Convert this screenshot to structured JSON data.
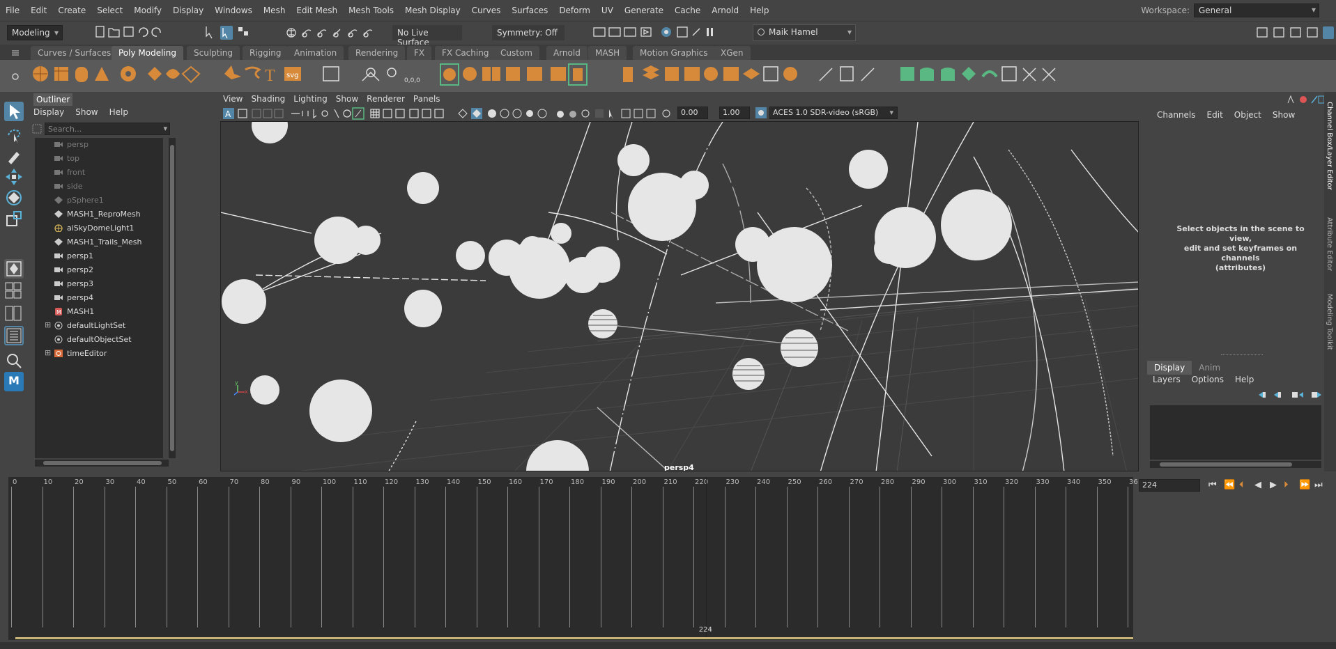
{
  "menubar": {
    "items": [
      "File",
      "Edit",
      "Create",
      "Select",
      "Modify",
      "Display",
      "Windows",
      "Mesh",
      "Edit Mesh",
      "Mesh Tools",
      "Mesh Display",
      "Curves",
      "Surfaces",
      "Deform",
      "UV",
      "Generate",
      "Cache",
      "Arnold",
      "Help"
    ],
    "workspace_label": "Workspace:",
    "workspace_value": "General"
  },
  "statusline": {
    "menuset": "Modeling",
    "live_surface": "No Live Surface",
    "symmetry": "Symmetry: Off",
    "user": "Maik Hamel"
  },
  "shelf": {
    "tabs": [
      "Curves / Surfaces",
      "Poly Modeling",
      "Sculpting",
      "Rigging",
      "Animation",
      "Rendering",
      "FX",
      "FX Caching",
      "Custom",
      "Arnold",
      "MASH",
      "Motion Graphics",
      "XGen"
    ],
    "active_tab": "Poly Modeling",
    "text_icon": "T",
    "svg_icon": "svg",
    "coord_icon": "0,0,0"
  },
  "outliner": {
    "title": "Outliner",
    "menu": [
      "Display",
      "Show",
      "Help"
    ],
    "search_placeholder": "Search...",
    "items": [
      {
        "label": "persp",
        "icon": "camera-icon",
        "dim": true
      },
      {
        "label": "top",
        "icon": "camera-icon",
        "dim": true
      },
      {
        "label": "front",
        "icon": "camera-icon",
        "dim": true
      },
      {
        "label": "side",
        "icon": "camera-icon",
        "dim": true
      },
      {
        "label": "pSphere1",
        "icon": "mesh-icon",
        "dim": true
      },
      {
        "label": "MASH1_ReproMesh",
        "icon": "mesh-icon",
        "dim": false
      },
      {
        "label": "aiSkyDomeLight1",
        "icon": "skydome-icon",
        "dim": false
      },
      {
        "label": "MASH1_Trails_Mesh",
        "icon": "mesh-icon",
        "dim": false
      },
      {
        "label": "persp1",
        "icon": "camera-icon",
        "dim": false
      },
      {
        "label": "persp2",
        "icon": "camera-icon",
        "dim": false
      },
      {
        "label": "persp3",
        "icon": "camera-icon",
        "dim": false
      },
      {
        "label": "persp4",
        "icon": "camera-icon",
        "dim": false
      },
      {
        "label": "MASH1",
        "icon": "mash-icon",
        "dim": false
      },
      {
        "label": "defaultLightSet",
        "icon": "set-icon",
        "dim": false,
        "expandable": true
      },
      {
        "label": "defaultObjectSet",
        "icon": "set-icon",
        "dim": false
      },
      {
        "label": "timeEditor",
        "icon": "time-editor-icon",
        "dim": false,
        "expandable": true
      }
    ]
  },
  "viewport": {
    "menu": [
      "View",
      "Shading",
      "Lighting",
      "Show",
      "Renderer",
      "Panels"
    ],
    "exposure": "0.00",
    "gamma": "1.00",
    "color_space": "ACES 1.0 SDR-video (sRGB)",
    "camera_label": "persp4"
  },
  "channelbox": {
    "menu": [
      "Channels",
      "Edit",
      "Object",
      "Show"
    ],
    "message_lines": [
      "Select objects in the scene to view,",
      "edit and set keyframes on channels",
      "(attributes)"
    ]
  },
  "layers": {
    "tabs": [
      "Display",
      "Anim"
    ],
    "active_tab": "Display",
    "menu": [
      "Layers",
      "Options",
      "Help"
    ]
  },
  "sidetabs": [
    "Channel Box/Layer Editor",
    "Attribute Editor",
    "Modeling Toolkit"
  ],
  "timeslider": {
    "ticks": [
      "0",
      "10",
      "20",
      "30",
      "40",
      "50",
      "60",
      "70",
      "80",
      "90",
      "100",
      "110",
      "120",
      "130",
      "140",
      "150",
      "160",
      "170",
      "180",
      "190",
      "200",
      "210",
      "220",
      "230",
      "240",
      "250",
      "260",
      "270",
      "280",
      "290",
      "300",
      "310",
      "320",
      "330",
      "340",
      "350",
      "36"
    ],
    "current_frame": "224",
    "current_value": 224
  },
  "colors": {
    "bg": "#444444",
    "accent": "#5285a6",
    "timeline_bar": "#c8b679",
    "shelf_orange": "#d78a3a",
    "shelf_green": "#5ab882"
  }
}
